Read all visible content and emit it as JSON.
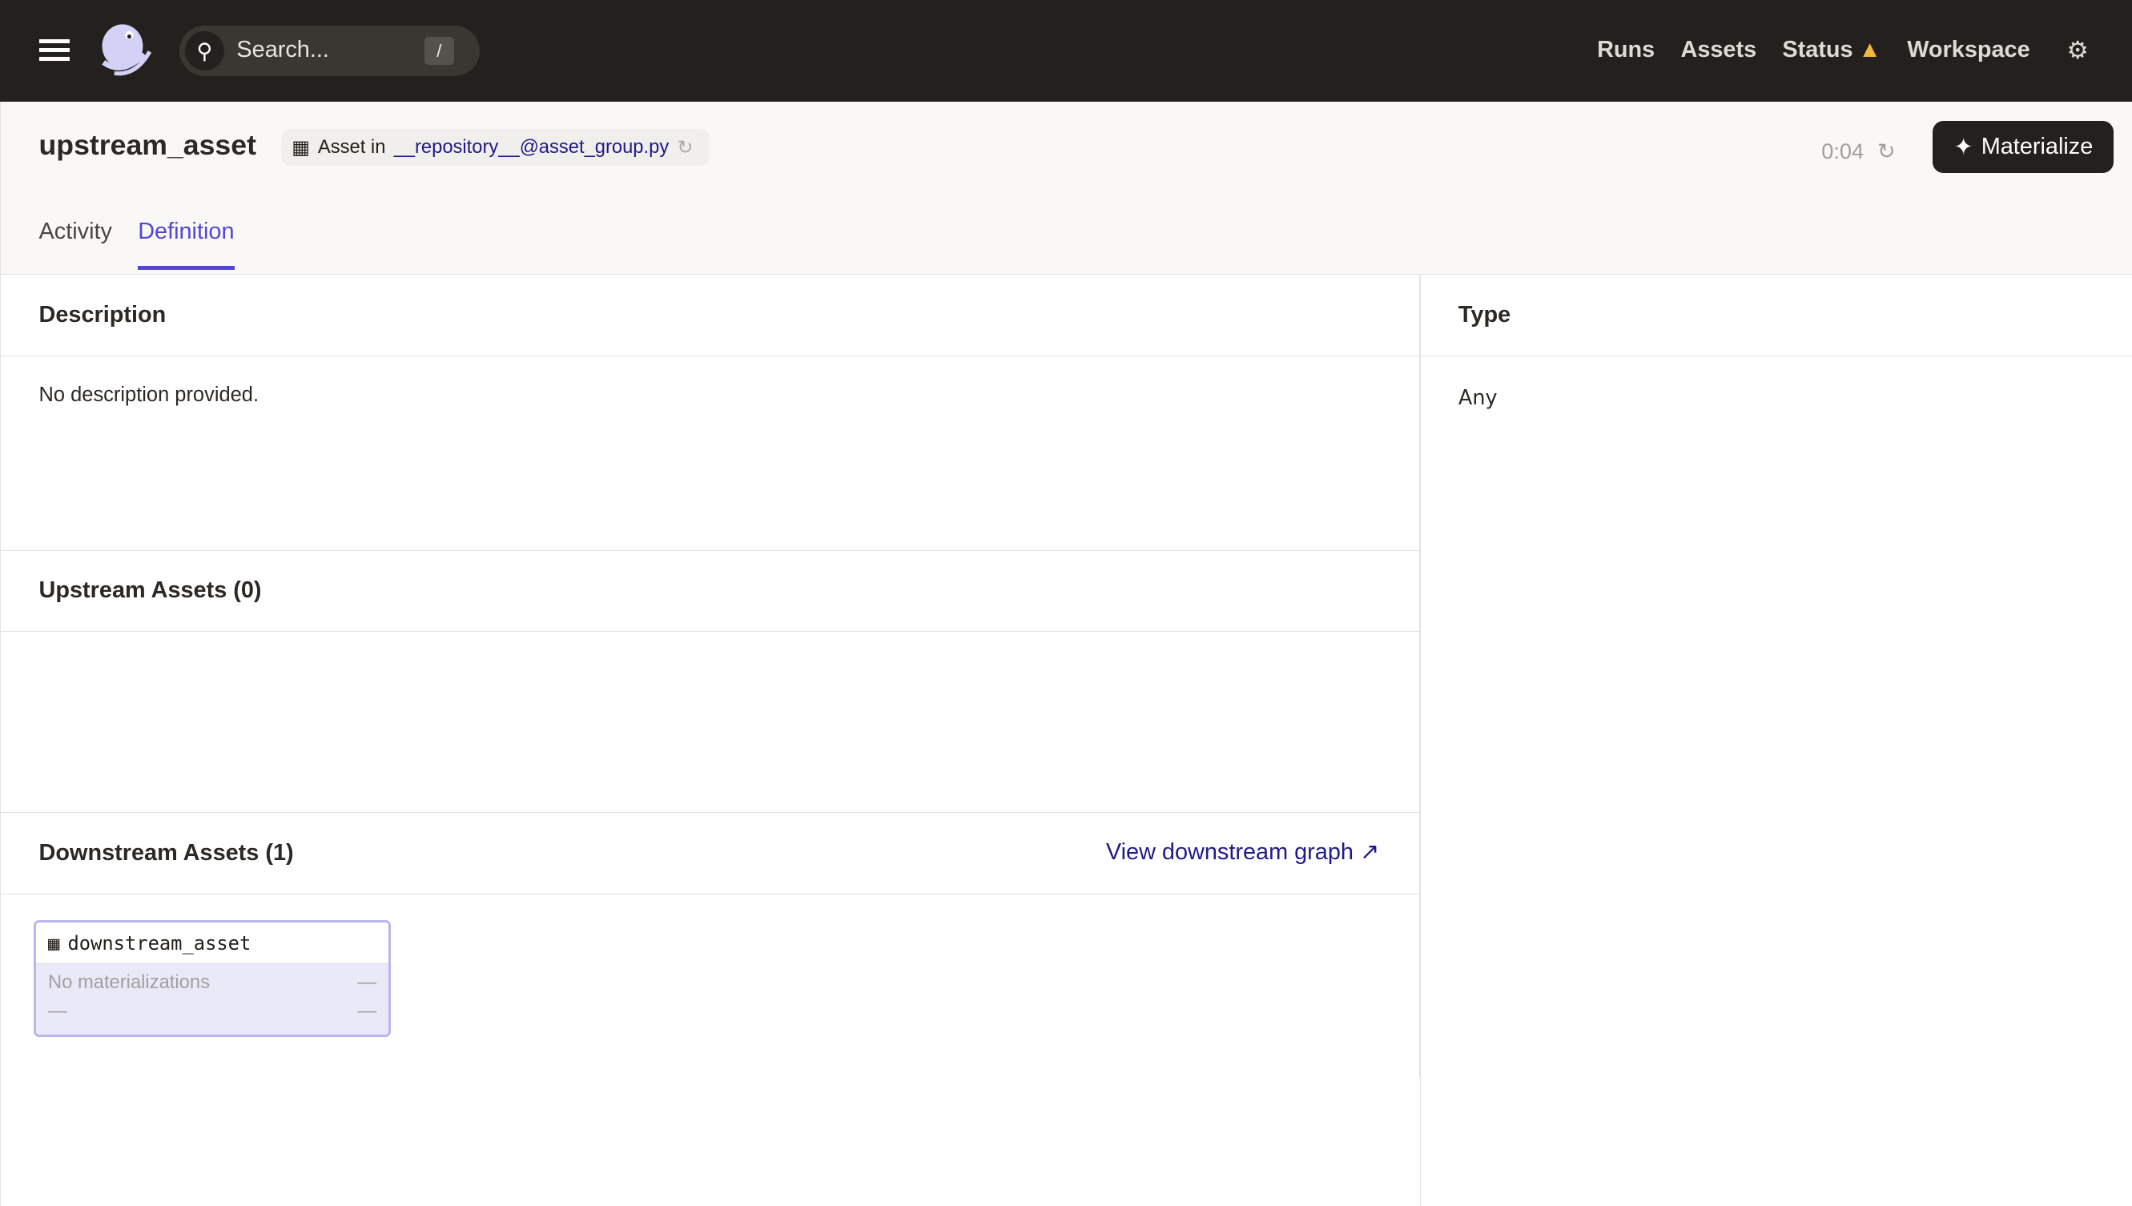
{
  "nav": {
    "search_placeholder": "Search...",
    "search_shortcut": "/",
    "links": [
      "Runs",
      "Assets",
      "Status",
      "Workspace"
    ],
    "status_warning_color": "#f6b53c"
  },
  "header": {
    "title": "upstream_asset",
    "repo_prefix": "Asset in",
    "repo_link": "__repository__@asset_group.py",
    "timer": "0:04",
    "materialize_label": "Materialize"
  },
  "tabs": [
    {
      "label": "Activity",
      "active": false
    },
    {
      "label": "Definition",
      "active": true
    }
  ],
  "sections": {
    "description": {
      "title": "Description",
      "text": "No description provided."
    },
    "upstream": {
      "title": "Upstream Assets (0)"
    },
    "downstream": {
      "title": "Downstream Assets (1)",
      "link": "View downstream graph",
      "asset": {
        "name": "downstream_asset",
        "status": "No materializations",
        "dash": "—"
      }
    },
    "type": {
      "title": "Type",
      "value": "Any"
    }
  },
  "accent": "#5346d4"
}
